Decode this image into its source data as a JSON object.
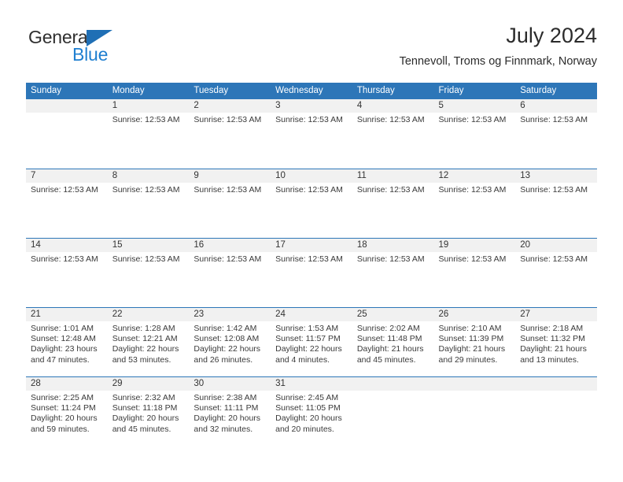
{
  "brand": {
    "name_part1": "General",
    "name_part2": "Blue",
    "accent_color": "#1f7fd0",
    "triangle_color": "#1f6fb5"
  },
  "header": {
    "title": "July 2024",
    "subtitle": "Tennevoll, Troms og Finnmark, Norway"
  },
  "theme": {
    "header_bg": "#2d76b8",
    "day_band_bg": "#f1f1f1",
    "grid_line": "#2d76b8"
  },
  "weekdays": [
    "Sunday",
    "Monday",
    "Tuesday",
    "Wednesday",
    "Thursday",
    "Friday",
    "Saturday"
  ],
  "weeks": [
    [
      {
        "day": "",
        "lines": []
      },
      {
        "day": "1",
        "lines": [
          "Sunrise: 12:53 AM"
        ]
      },
      {
        "day": "2",
        "lines": [
          "Sunrise: 12:53 AM"
        ]
      },
      {
        "day": "3",
        "lines": [
          "Sunrise: 12:53 AM"
        ]
      },
      {
        "day": "4",
        "lines": [
          "Sunrise: 12:53 AM"
        ]
      },
      {
        "day": "5",
        "lines": [
          "Sunrise: 12:53 AM"
        ]
      },
      {
        "day": "6",
        "lines": [
          "Sunrise: 12:53 AM"
        ]
      }
    ],
    [
      {
        "day": "7",
        "lines": [
          "Sunrise: 12:53 AM"
        ]
      },
      {
        "day": "8",
        "lines": [
          "Sunrise: 12:53 AM"
        ]
      },
      {
        "day": "9",
        "lines": [
          "Sunrise: 12:53 AM"
        ]
      },
      {
        "day": "10",
        "lines": [
          "Sunrise: 12:53 AM"
        ]
      },
      {
        "day": "11",
        "lines": [
          "Sunrise: 12:53 AM"
        ]
      },
      {
        "day": "12",
        "lines": [
          "Sunrise: 12:53 AM"
        ]
      },
      {
        "day": "13",
        "lines": [
          "Sunrise: 12:53 AM"
        ]
      }
    ],
    [
      {
        "day": "14",
        "lines": [
          "Sunrise: 12:53 AM"
        ]
      },
      {
        "day": "15",
        "lines": [
          "Sunrise: 12:53 AM"
        ]
      },
      {
        "day": "16",
        "lines": [
          "Sunrise: 12:53 AM"
        ]
      },
      {
        "day": "17",
        "lines": [
          "Sunrise: 12:53 AM"
        ]
      },
      {
        "day": "18",
        "lines": [
          "Sunrise: 12:53 AM"
        ]
      },
      {
        "day": "19",
        "lines": [
          "Sunrise: 12:53 AM"
        ]
      },
      {
        "day": "20",
        "lines": [
          "Sunrise: 12:53 AM"
        ]
      }
    ],
    [
      {
        "day": "21",
        "lines": [
          "Sunrise: 1:01 AM",
          "Sunset: 12:48 AM",
          "Daylight: 23 hours",
          "and 47 minutes."
        ]
      },
      {
        "day": "22",
        "lines": [
          "Sunrise: 1:28 AM",
          "Sunset: 12:21 AM",
          "Daylight: 22 hours",
          "and 53 minutes."
        ]
      },
      {
        "day": "23",
        "lines": [
          "Sunrise: 1:42 AM",
          "Sunset: 12:08 AM",
          "Daylight: 22 hours",
          "and 26 minutes."
        ]
      },
      {
        "day": "24",
        "lines": [
          "Sunrise: 1:53 AM",
          "Sunset: 11:57 PM",
          "Daylight: 22 hours",
          "and 4 minutes."
        ]
      },
      {
        "day": "25",
        "lines": [
          "Sunrise: 2:02 AM",
          "Sunset: 11:48 PM",
          "Daylight: 21 hours",
          "and 45 minutes."
        ]
      },
      {
        "day": "26",
        "lines": [
          "Sunrise: 2:10 AM",
          "Sunset: 11:39 PM",
          "Daylight: 21 hours",
          "and 29 minutes."
        ]
      },
      {
        "day": "27",
        "lines": [
          "Sunrise: 2:18 AM",
          "Sunset: 11:32 PM",
          "Daylight: 21 hours",
          "and 13 minutes."
        ]
      }
    ],
    [
      {
        "day": "28",
        "lines": [
          "Sunrise: 2:25 AM",
          "Sunset: 11:24 PM",
          "Daylight: 20 hours",
          "and 59 minutes."
        ]
      },
      {
        "day": "29",
        "lines": [
          "Sunrise: 2:32 AM",
          "Sunset: 11:18 PM",
          "Daylight: 20 hours",
          "and 45 minutes."
        ]
      },
      {
        "day": "30",
        "lines": [
          "Sunrise: 2:38 AM",
          "Sunset: 11:11 PM",
          "Daylight: 20 hours",
          "and 32 minutes."
        ]
      },
      {
        "day": "31",
        "lines": [
          "Sunrise: 2:45 AM",
          "Sunset: 11:05 PM",
          "Daylight: 20 hours",
          "and 20 minutes."
        ]
      },
      {
        "day": "",
        "lines": []
      },
      {
        "day": "",
        "lines": []
      },
      {
        "day": "",
        "lines": []
      }
    ]
  ]
}
